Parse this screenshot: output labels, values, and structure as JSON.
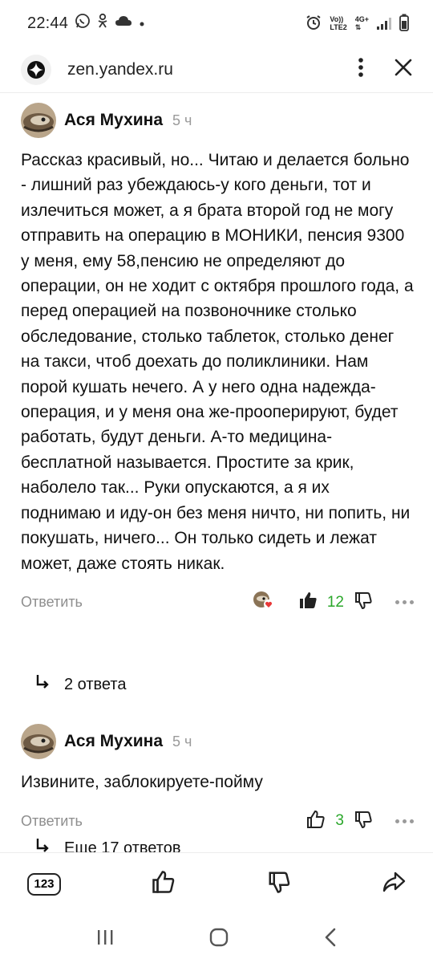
{
  "status_bar": {
    "time": "22:44",
    "network_top": "Vo))",
    "network_bottom": "LTE2",
    "data_top": "4G+"
  },
  "browser": {
    "url": "zen.yandex.ru"
  },
  "comments": [
    {
      "author": "Ася Мухина",
      "time_ago": "5 ч",
      "text": "Рассказ красивый, но... Читаю и делается больно - лишний раз убеждаюсь-у кого деньги, тот и излечиться может, а я брата второй год не могу отправить на операцию в МОНИКИ, пенсия 9300 у меня, ему 58,пенсию не определяют до операции, он не ходит с октября прошлого года, а перед операцией на позвоночнике столько обследование, столько таблеток, столько денег на такси, чтоб доехать до поликлиники. Нам порой кушать нечего. А у него одна надежда-операция, и у меня она же-прооперируют, будет работать, будут деньги. А-то медицина-бесплатной называется. Простите за крик, наболело так... Руки опускаются, а я их поднимаю и иду-он без меня ничто, ни попить, ни покушать, ничего... Он только сидеть и лежат может, даже стоять никак.",
      "reply_label": "Ответить",
      "likes": "12",
      "replies_label": "2 ответа"
    },
    {
      "author": "Ася Мухина",
      "time_ago": "5 ч",
      "text": "Извините, заблокируете-пойму",
      "reply_label": "Ответить",
      "likes": "3",
      "replies_label": "Еще 17 ответов"
    }
  ],
  "toolbar": {
    "tabs_count": "123"
  },
  "colors": {
    "like_count": "#2aa72a",
    "muted": "#8e8e8e"
  }
}
